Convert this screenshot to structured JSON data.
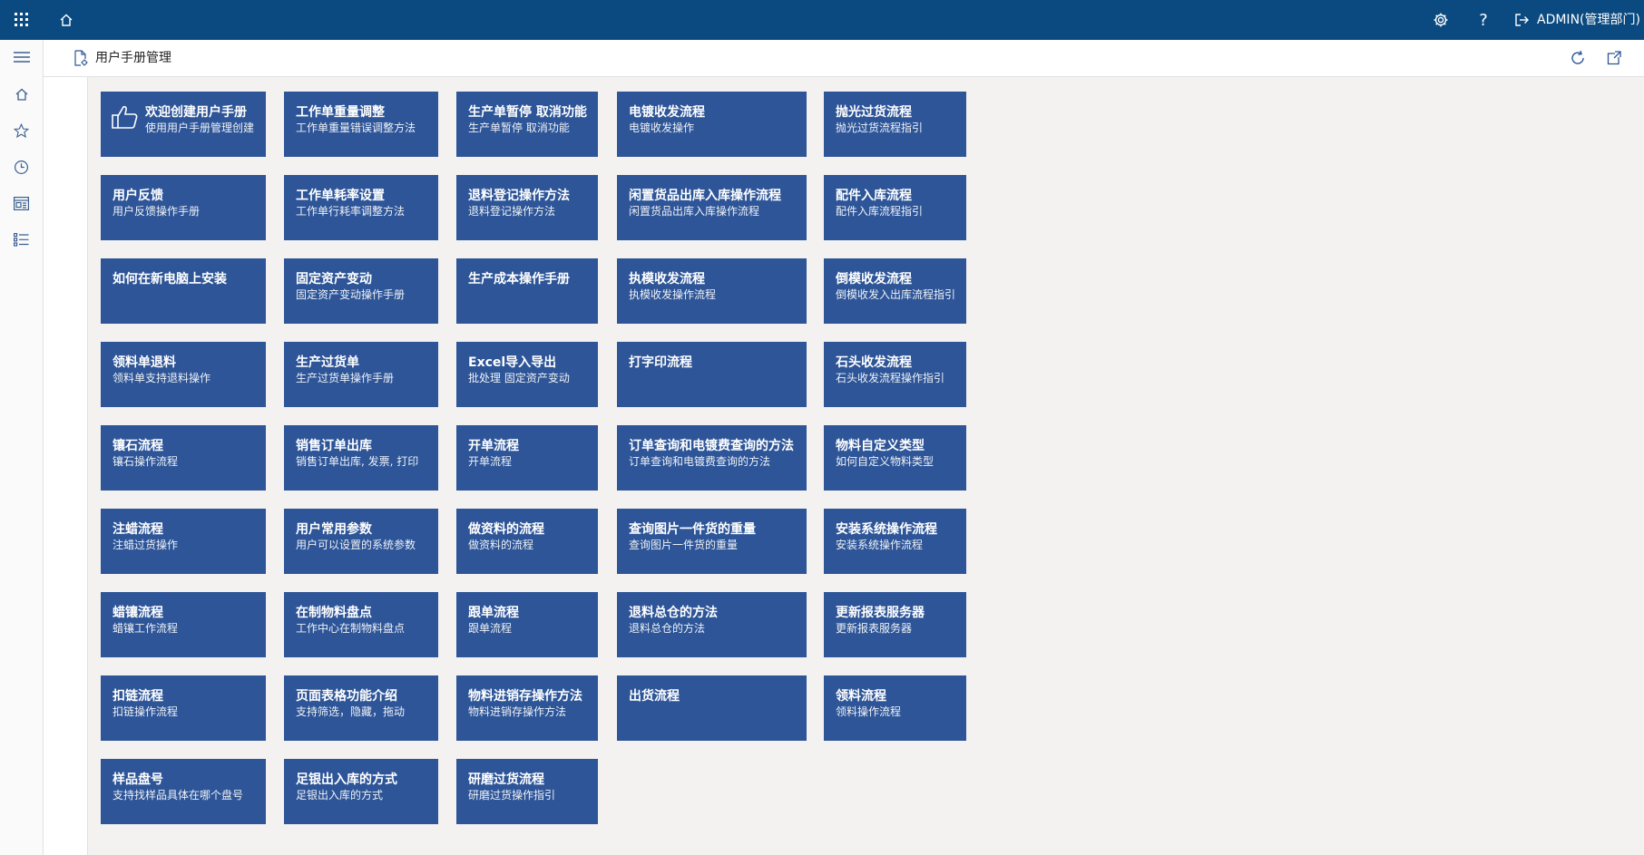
{
  "topbar": {
    "user_label": "ADMIN(管理部门)"
  },
  "header": {
    "title": "用户手册管理"
  },
  "tiles": [
    {
      "title": "欢迎创建用户手册",
      "subtitle": "使用用户手册管理创建",
      "icon": "thumbs-up-icon"
    },
    {
      "title": "工作单重量调整",
      "subtitle": "工作单重量错误调整方法"
    },
    {
      "title": "生产单暂停 取消功能",
      "subtitle": "生产单暂停 取消功能"
    },
    {
      "title": "电镀收发流程",
      "subtitle": "电镀收发操作"
    },
    {
      "title": "抛光过货流程",
      "subtitle": "抛光过货流程指引"
    },
    {
      "title": "用户反馈",
      "subtitle": "用户反馈操作手册"
    },
    {
      "title": "工作单耗率设置",
      "subtitle": "工作单行耗率调整方法"
    },
    {
      "title": "退料登记操作方法",
      "subtitle": "退料登记操作方法"
    },
    {
      "title": "闲置货品出库入库操作流程",
      "subtitle": "闲置货品出库入库操作流程"
    },
    {
      "title": "配件入库流程",
      "subtitle": "配件入库流程指引"
    },
    {
      "title": "如何在新电脑上安装",
      "subtitle": ""
    },
    {
      "title": "固定资产变动",
      "subtitle": "固定资产变动操作手册"
    },
    {
      "title": "生产成本操作手册",
      "subtitle": ""
    },
    {
      "title": "执模收发流程",
      "subtitle": "执模收发操作流程"
    },
    {
      "title": "倒模收发流程",
      "subtitle": "倒模收发入出库流程指引"
    },
    {
      "title": "领料单退料",
      "subtitle": "领料单支持退料操作"
    },
    {
      "title": "生产过货单",
      "subtitle": "生产过货单操作手册"
    },
    {
      "title": "Excel导入导出",
      "subtitle": "批处理 固定资产变动"
    },
    {
      "title": "打字印流程",
      "subtitle": ""
    },
    {
      "title": "石头收发流程",
      "subtitle": "石头收发流程操作指引"
    },
    {
      "title": "镶石流程",
      "subtitle": "镶石操作流程"
    },
    {
      "title": "销售订单出库",
      "subtitle": "销售订单出库, 发票, 打印"
    },
    {
      "title": "开单流程",
      "subtitle": "开单流程"
    },
    {
      "title": "订单查询和电镀费查询的方法",
      "subtitle": "订单查询和电镀费查询的方法"
    },
    {
      "title": "物料自定义类型",
      "subtitle": "如何自定义物料类型"
    },
    {
      "title": "注蜡流程",
      "subtitle": "注蜡过货操作"
    },
    {
      "title": "用户常用参数",
      "subtitle": "用户可以设置的系统参数"
    },
    {
      "title": "做资料的流程",
      "subtitle": "做资料的流程"
    },
    {
      "title": "查询图片一件货的重量",
      "subtitle": "查询图片一件货的重量"
    },
    {
      "title": "安装系统操作流程",
      "subtitle": "安装系统操作流程"
    },
    {
      "title": "蜡镶流程",
      "subtitle": "蜡镶工作流程"
    },
    {
      "title": "在制物料盘点",
      "subtitle": "工作中心在制物料盘点"
    },
    {
      "title": "跟单流程",
      "subtitle": "跟单流程"
    },
    {
      "title": "退料总仓的方法",
      "subtitle": "退料总仓的方法"
    },
    {
      "title": "更新报表服务器",
      "subtitle": "更新报表服务器"
    },
    {
      "title": "扣链流程",
      "subtitle": "扣链操作流程"
    },
    {
      "title": "页面表格功能介绍",
      "subtitle": "支持筛选，隐藏，拖动"
    },
    {
      "title": "物料进销存操作方法",
      "subtitle": "物料进销存操作方法"
    },
    {
      "title": "出货流程",
      "subtitle": ""
    },
    {
      "title": "领料流程",
      "subtitle": "领料操作流程"
    },
    {
      "title": "样品盘号",
      "subtitle": "支持找样品具体在哪个盘号"
    },
    {
      "title": "足银出入库的方式",
      "subtitle": "足银出入库的方式"
    },
    {
      "title": "研磨过货流程",
      "subtitle": "研磨过货操作指引"
    }
  ]
}
